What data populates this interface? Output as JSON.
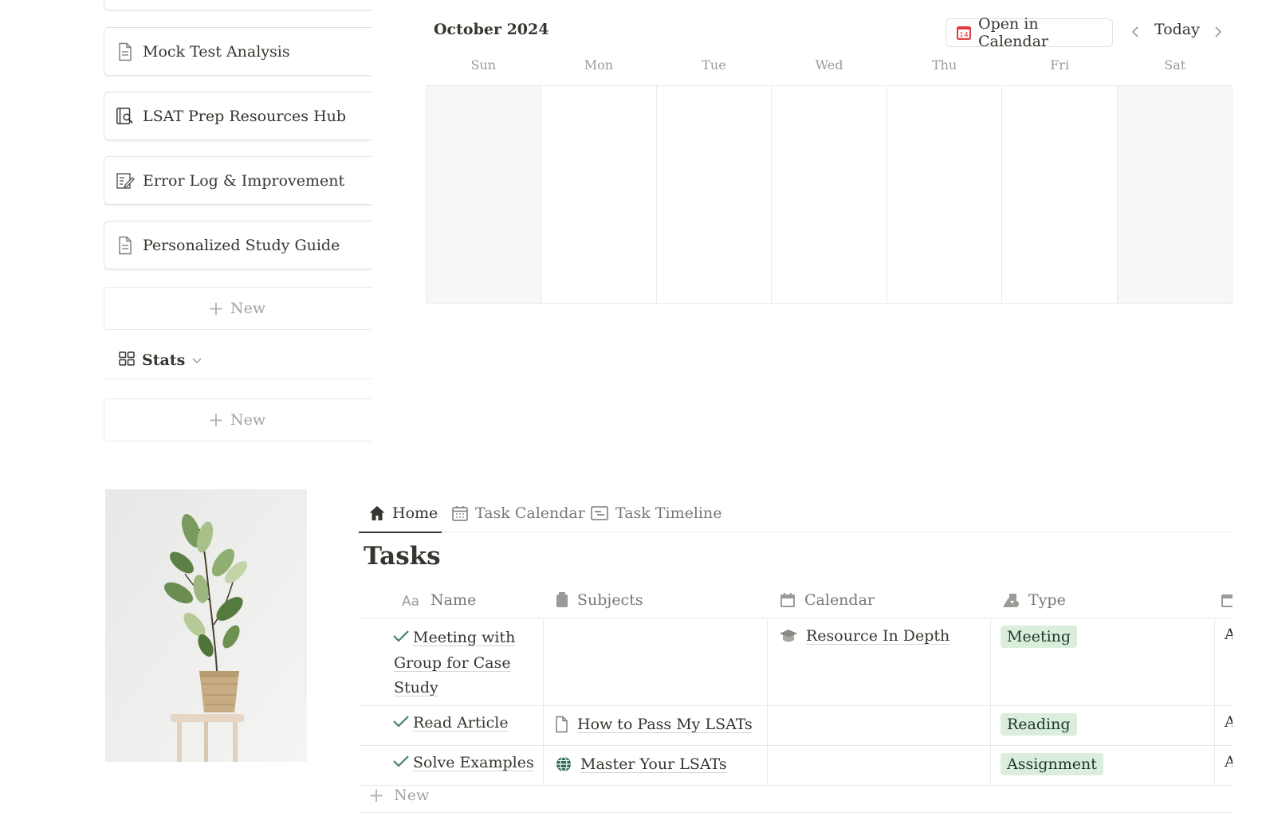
{
  "left_panel": {
    "cards": [
      {
        "label": "Mock Test Analysis",
        "icon": "document-icon"
      },
      {
        "label": "LSAT Prep Resources Hub",
        "icon": "book-search-icon"
      },
      {
        "label": "Error Log & Improvement",
        "icon": "edit-list-icon"
      },
      {
        "label": "Personalized Study Guide",
        "icon": "document-icon"
      }
    ],
    "new_label": "New",
    "stats_label": "Stats",
    "new_label_2": "New"
  },
  "calendar": {
    "month": "October 2024",
    "open_button": "Open in Calendar",
    "today_button": "Today",
    "days": [
      "Sun",
      "Mon",
      "Tue",
      "Wed",
      "Thu",
      "Fri",
      "Sat"
    ],
    "icon_colors": {
      "open_calendar": "#e03e3e"
    }
  },
  "tabs": [
    {
      "label": "Home",
      "icon": "home-icon",
      "active": true
    },
    {
      "label": "Task Calendar",
      "icon": "calendar-icon",
      "active": false
    },
    {
      "label": "Task Timeline",
      "icon": "timeline-icon",
      "active": false
    }
  ],
  "tasks": {
    "title": "Tasks",
    "columns": [
      "Name",
      "Subjects",
      "Calendar",
      "Type"
    ],
    "rows": [
      {
        "name": "Meeting with Group for Case Study",
        "subject": "",
        "calendar": "Resource In Depth",
        "type": "Meeting",
        "more": "A"
      },
      {
        "name": "Read Article",
        "subject": "How to Pass My LSATs",
        "calendar": "",
        "type": "Reading",
        "more": "A"
      },
      {
        "name": "Solve Examples",
        "subject": "Master Your LSATs",
        "calendar": "",
        "type": "Assignment",
        "more": "A"
      }
    ],
    "new_label": "New",
    "tag_color": "#dbeddb",
    "check_color": "#448361"
  }
}
